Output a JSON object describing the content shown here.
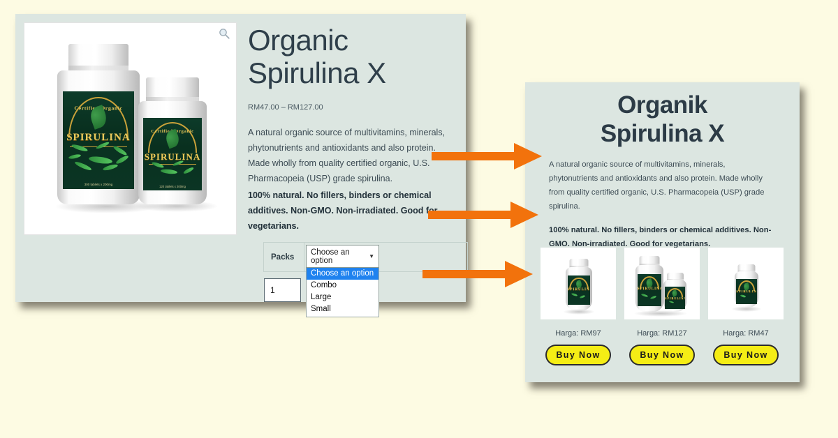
{
  "page": {
    "background_color": "#FDFBE3",
    "panel_color": "#DCE6E1",
    "accent_color": "#F2720C",
    "buy_button_color": "#F5ED15"
  },
  "left_panel": {
    "name": "woocommerce-product-page",
    "gallery": {
      "zoom_icon": "magnifier-icon",
      "bottles": [
        {
          "brand": "SPIRULINA",
          "arc_text": "Certified Organic",
          "tablets": "300 tablets x 200mg"
        },
        {
          "brand": "SPIRULINA",
          "arc_text": "Certified Organic",
          "tablets": "120 tablets x 200mg"
        }
      ]
    },
    "title_line1": "Organic",
    "title_line2": "Spirulina X",
    "price_range": "RM47.00 – RM127.00",
    "description": "A natural organic source of multivitamins, minerals, phytonutrients and antioxidants and also protein. Made wholly from quality certified organic, U.S. Pharmacopeia (USP) grade spirulina.",
    "description_bold": "100% natural. No fillers, binders or chemical additives. Non-GMO. Non-irradiated. Good for vegetarians.",
    "variation": {
      "attribute_label": "Packs",
      "select_value": "Choose an option",
      "caret_icon": "chevron-down-icon",
      "options": [
        "Choose an option",
        "Combo",
        "Large",
        "Small"
      ],
      "selected_index": 0
    },
    "quantity_value": "1"
  },
  "right_panel": {
    "name": "landing-page-preview",
    "title_line1": "Organik",
    "title_line2": "Spirulina X",
    "description": "A natural organic source of multivitamins, minerals, phytonutrients and antioxidants and also protein. Made wholly from quality certified organic, U.S. Pharmacopeia (USP) grade spirulina.",
    "description_bold": "100% natural. No fillers, binders or chemical additives. Non-GMO. Non-irradiated. Good for vegetarians.",
    "cards": [
      {
        "image_alt": "single-large-bottle",
        "price_label": "Harga: RM97",
        "button_label": "Buy Now"
      },
      {
        "image_alt": "combo-two-bottles",
        "price_label": "Harga: RM127",
        "button_label": "Buy Now"
      },
      {
        "image_alt": "single-small-bottle",
        "price_label": "Harga: RM47",
        "button_label": "Buy Now"
      }
    ]
  },
  "arrows": [
    {
      "name": "arrow-description",
      "label": ""
    },
    {
      "name": "arrow-bold-description",
      "label": ""
    },
    {
      "name": "arrow-product-options",
      "label": ""
    }
  ]
}
